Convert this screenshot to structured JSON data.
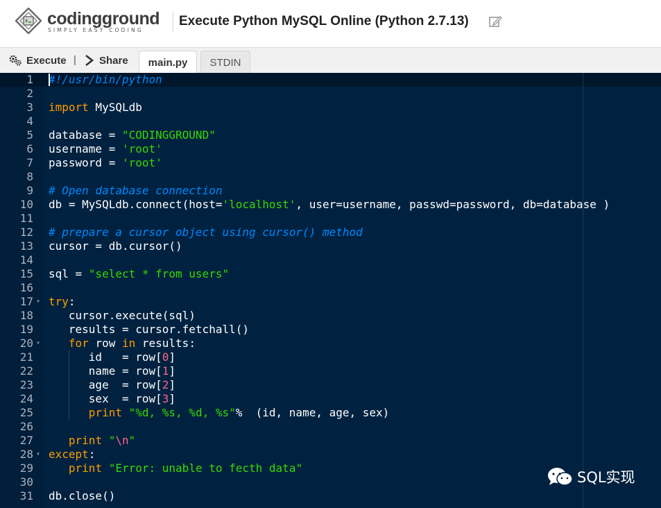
{
  "header": {
    "logo_name": "codingground",
    "logo_tagline": "SIMPLY EASY CODING",
    "title": "Execute Python MySQL Online (Python 2.7.13)"
  },
  "toolbar": {
    "execute_label": "Execute",
    "separator": "|",
    "share_label": "Share",
    "tabs": [
      {
        "label": "main.py",
        "active": true
      },
      {
        "label": "STDIN",
        "active": false
      }
    ]
  },
  "editor": {
    "theme_bg": "#002240",
    "lines": [
      {
        "n": "1",
        "html": "<span class=\"com\">#!/usr/bin/python</span>"
      },
      {
        "n": "2",
        "html": ""
      },
      {
        "n": "3",
        "html": "<span class=\"kw\">import</span> MySQLdb"
      },
      {
        "n": "4",
        "html": ""
      },
      {
        "n": "5",
        "html": "database = <span class=\"str\">\"CODINGGROUND\"</span>"
      },
      {
        "n": "6",
        "html": "username = <span class=\"str\">'root'</span>"
      },
      {
        "n": "7",
        "html": "password = <span class=\"str\">'root'</span>"
      },
      {
        "n": "8",
        "html": ""
      },
      {
        "n": "9",
        "html": "<span class=\"com\"># Open database connection</span>"
      },
      {
        "n": "10",
        "html": "db = MySQLdb.connect(host=<span class=\"str\">'localhost'</span>, user=username, passwd=password, db=database )"
      },
      {
        "n": "11",
        "html": ""
      },
      {
        "n": "12",
        "html": "<span class=\"com\"># prepare a cursor object using cursor() method</span>"
      },
      {
        "n": "13",
        "html": "cursor = db.cursor()"
      },
      {
        "n": "14",
        "html": ""
      },
      {
        "n": "15",
        "html": "sql = <span class=\"str\">\"select * from users\"</span>"
      },
      {
        "n": "16",
        "html": ""
      },
      {
        "n": "17",
        "html": "<span class=\"kw\">try</span>:",
        "fold": true
      },
      {
        "n": "18",
        "html": "   cursor.execute(sql)"
      },
      {
        "n": "19",
        "html": "   results = cursor.fetchall()"
      },
      {
        "n": "20",
        "html": "   <span class=\"kw\">for</span> row <span class=\"kw\">in</span> results:",
        "fold": true
      },
      {
        "n": "21",
        "html": "      id   = row[<span class=\"num\">0</span>]"
      },
      {
        "n": "22",
        "html": "      name = row[<span class=\"num\">1</span>]"
      },
      {
        "n": "23",
        "html": "      age  = row[<span class=\"num\">2</span>]"
      },
      {
        "n": "24",
        "html": "      sex  = row[<span class=\"num\">3</span>]"
      },
      {
        "n": "25",
        "html": "      <span class=\"kw\">print</span> <span class=\"str\">\"%d, %s, %d, %s\"</span>%  (id, name, age, sex)"
      },
      {
        "n": "26",
        "html": ""
      },
      {
        "n": "27",
        "html": "   <span class=\"kw\">print</span> <span class=\"str\">\"<span class=\"esc\">\\n</span>\"</span>"
      },
      {
        "n": "28",
        "html": "<span class=\"kw\">except</span>:",
        "fold": true
      },
      {
        "n": "29",
        "html": "   <span class=\"kw\">print</span> <span class=\"str\">\"Error: unable to fecth data\"</span>"
      },
      {
        "n": "30",
        "html": ""
      },
      {
        "n": "31",
        "html": "db.close()"
      }
    ]
  },
  "watermark": {
    "text": "SQL实现"
  }
}
